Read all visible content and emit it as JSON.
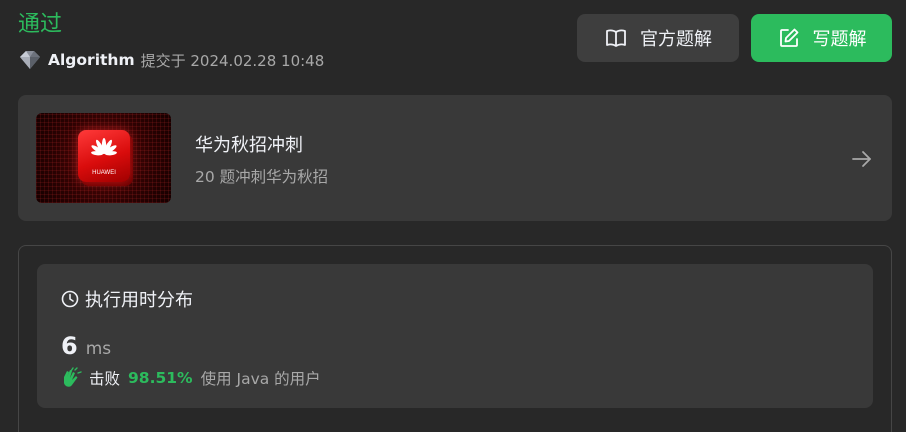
{
  "status": {
    "title": "通过",
    "color": "#2cbb5d"
  },
  "submission": {
    "username": "Algorithm",
    "submitted_text": "提交于 2024.02.28 10:48"
  },
  "buttons": {
    "official_solution": {
      "label": "官方题解",
      "icon": "book-open-icon"
    },
    "write_solution": {
      "label": "写题解",
      "icon": "edit-icon"
    }
  },
  "study_plan": {
    "title": "华为秋招冲刺",
    "subtitle": "20 题冲刺华为秋招",
    "thumbnail_logo_text": "HUAWEI",
    "arrow_icon": "arrow-right-icon"
  },
  "runtime": {
    "heading": "执行用时分布",
    "value": "6",
    "unit": "ms",
    "beats_label": "击败",
    "beats_percent": "98.51%",
    "beats_tail": "使用 Java 的用户"
  }
}
